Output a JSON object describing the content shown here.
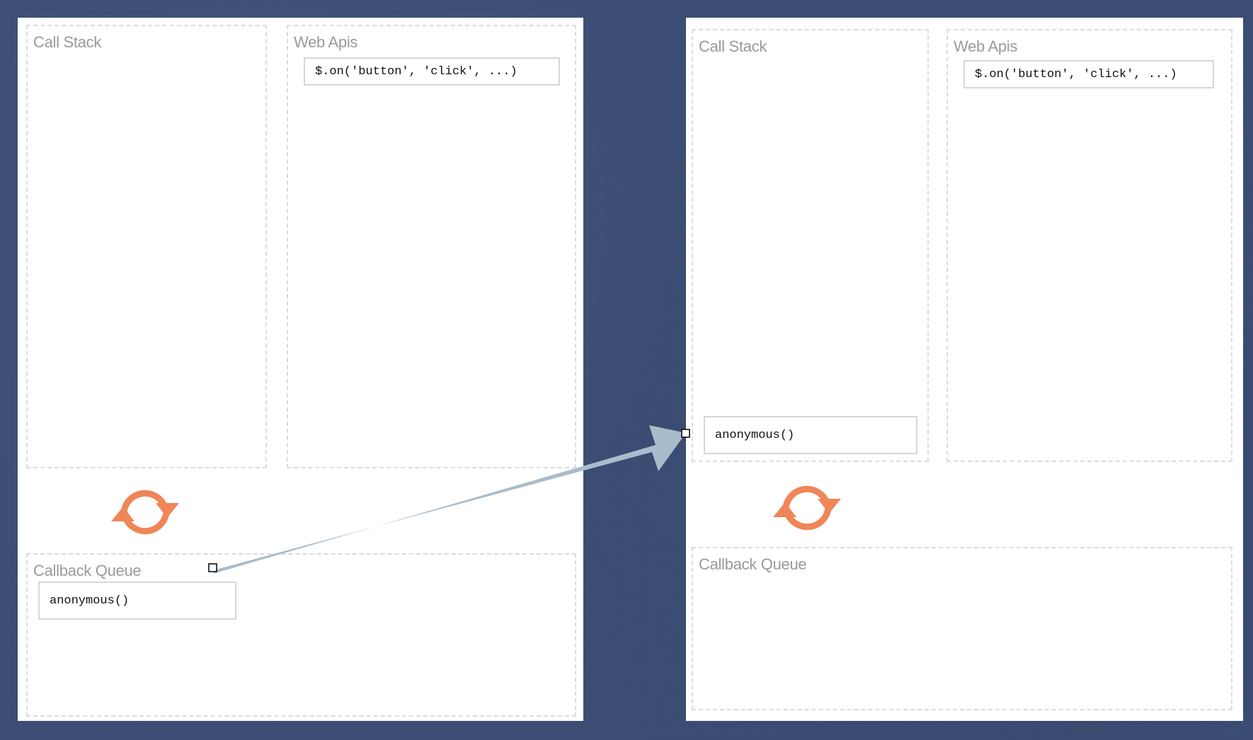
{
  "left_panel": {
    "call_stack": {
      "title": "Call Stack"
    },
    "web_apis": {
      "title": "Web Apis",
      "items": [
        "$.on('button', 'click', ...)"
      ]
    },
    "event_loop": {
      "icon": "refresh-cycle-icon"
    },
    "callback_queue": {
      "title": "Callback Queue",
      "items": [
        "anonymous()"
      ]
    }
  },
  "right_panel": {
    "call_stack": {
      "title": "Call Stack",
      "items": [
        "anonymous()"
      ]
    },
    "web_apis": {
      "title": "Web Apis",
      "items": [
        "$.on('button', 'click', ...)"
      ]
    },
    "event_loop": {
      "icon": "refresh-cycle-icon"
    },
    "callback_queue": {
      "title": "Callback Queue"
    }
  },
  "connector": {
    "icon": "arrow-icon"
  },
  "colors": {
    "background": "#3a4d74",
    "panel": "#ffffff",
    "dashed_border": "#dcdcdc",
    "title_text": "#9a9a9a",
    "loop_icon": "#ef8657",
    "arrow": "#a9bccb"
  }
}
